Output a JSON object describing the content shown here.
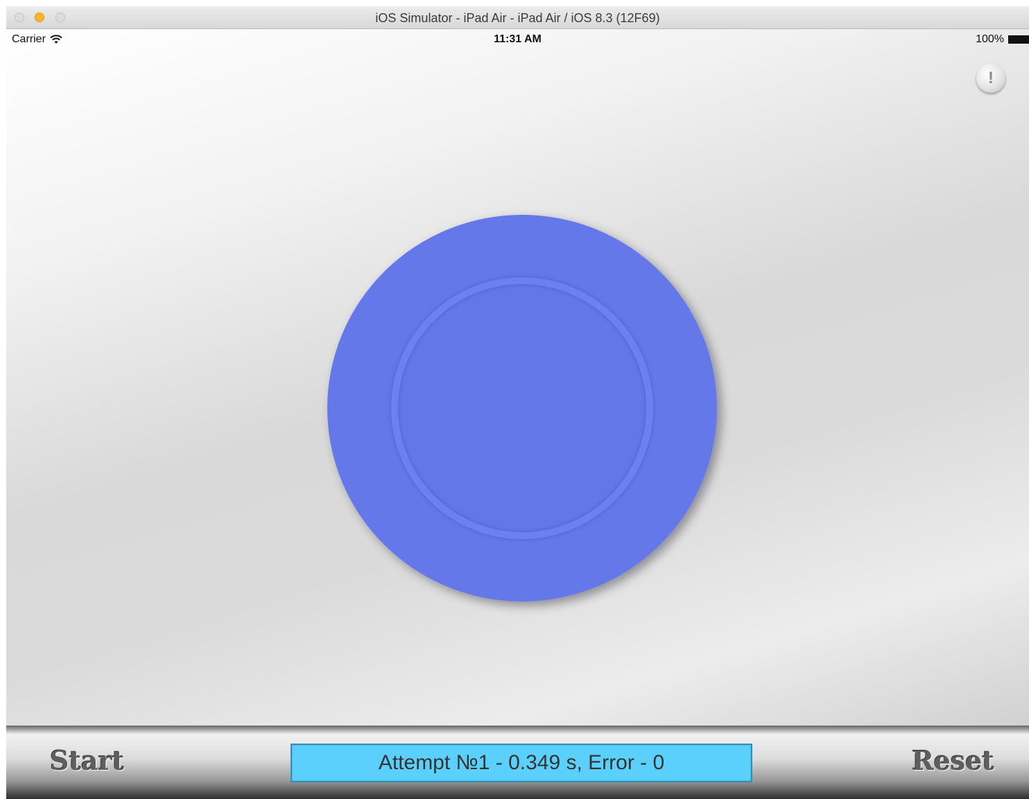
{
  "window": {
    "title": "iOS Simulator - iPad Air - iPad Air / iOS 8.3 (12F69)"
  },
  "statusbar": {
    "carrier": "Carrier",
    "time": "11:31 AM",
    "battery": "100%"
  },
  "info_button": {
    "label": "!"
  },
  "bottom_bar": {
    "start_label": "Start",
    "result_text": "Attempt №1 - 0.349 s, Error - 0",
    "reset_label": "Reset"
  },
  "colors": {
    "disc": "#6478ea",
    "result_background": "#5cd0fc"
  }
}
